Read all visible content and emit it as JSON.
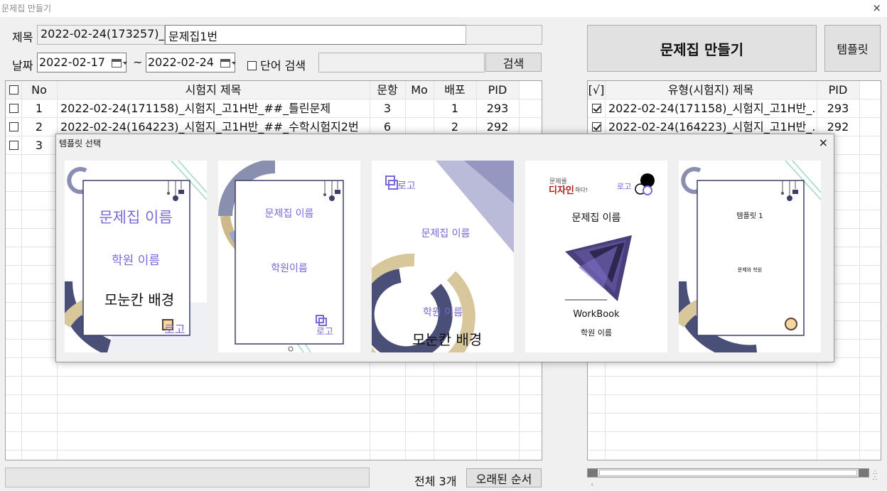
{
  "window": {
    "title": "문제집 만들기",
    "close": "×"
  },
  "form": {
    "title_label": "제목",
    "title_prefix": "2022-02-24(173257)_",
    "title_name": "문제집1번",
    "title_extra": "",
    "date_label": "날짜",
    "date_from": "2022-02-17",
    "tilde": "~",
    "date_to": "2022-02-24",
    "word_search_label": "단어 검색",
    "search_value": "",
    "search_button": "검색",
    "make_button": "문제집 만들기",
    "template_button": "템플릿"
  },
  "left_table": {
    "headers": [
      "No",
      "시험지 제목",
      "문항",
      "Mo",
      "배포",
      "PID"
    ],
    "rows": [
      {
        "no": "1",
        "title": "2022-02-24(171158)_시험지_고1H반_##_틀린문제",
        "items": "3",
        "mo": "",
        "dist": "1",
        "pid": "293"
      },
      {
        "no": "2",
        "title": "2022-02-24(164223)_시험지_고1H반_##_수학시험지2번",
        "items": "6",
        "mo": "",
        "dist": "2",
        "pid": "292"
      },
      {
        "no": "3",
        "title": "",
        "items": "",
        "mo": "",
        "dist": "",
        "pid": ""
      }
    ]
  },
  "right_table": {
    "check_header": "[√]",
    "headers": [
      "유형(시험지) 제목",
      "PID"
    ],
    "rows": [
      {
        "title": "2022-02-24(171158)_시험지_고1H반_...",
        "pid": "293",
        "checked": true
      },
      {
        "title": "2022-02-24(164223)_시험지_고1H반_...",
        "pid": "292",
        "checked": true
      }
    ]
  },
  "footer": {
    "total": "전체 3개",
    "sort_button": "오래된 순서"
  },
  "modal": {
    "title": "템플릿 선택",
    "close": "×",
    "templates": [
      {
        "book_name": "문제집 이름",
        "academy_name": "학원 이름",
        "bg_caption": "모눈칸 배경",
        "logo": "로고"
      },
      {
        "book_name": "문제집 이름",
        "academy_name": "학원이름",
        "logo": "로고"
      },
      {
        "logo": "로고",
        "book_name": "문제집 이름",
        "academy_name": "학원 이름",
        "bg_caption": "모눈칸 배경"
      },
      {
        "brand_top": "문제를",
        "brand_main": "디자인",
        "brand_tail": "하다!",
        "logo": "로고",
        "book_name": "문제집 이름",
        "workbook": "WorkBook",
        "academy_name": "학원 이름"
      },
      {
        "name": "템플릿 1",
        "sub": "문제와 학원"
      }
    ]
  },
  "colors": {
    "accent_purple": "#7b68d6",
    "dark_purple": "#4a3f7a",
    "gold": "#cdb98a",
    "mint": "#7fcab8",
    "navy": "#3b3f6a"
  }
}
